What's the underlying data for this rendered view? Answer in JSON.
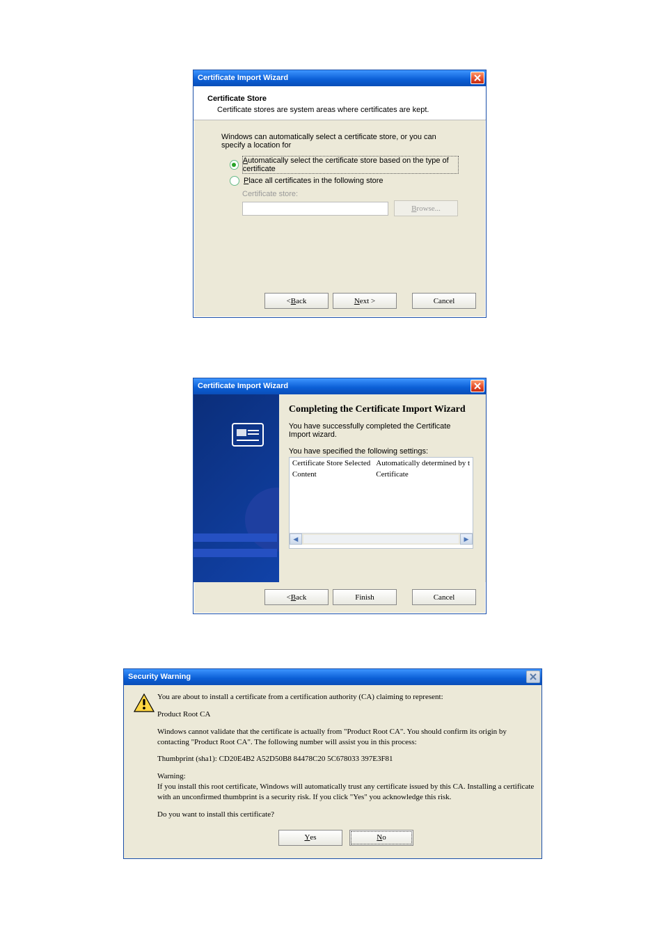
{
  "dialog1": {
    "title": "Certificate Import Wizard",
    "header_title": "Certificate Store",
    "header_sub": "Certificate stores are system areas where certificates are kept.",
    "intro": "Windows can automatically select a certificate store, or you can specify a location for",
    "option_auto_pre": "A",
    "option_auto_rest": "utomatically select the certificate store based on the type of certificate",
    "option_place_pre": "P",
    "option_place_rest": "lace all certificates in the following store",
    "cert_store_label": "Certificate store:",
    "browse_pre": "B",
    "browse_post": "rowse...",
    "back_lt": "< ",
    "back_pre": "B",
    "back_post": "ack",
    "next_pre": "N",
    "next_post": "ext >",
    "cancel": "Cancel"
  },
  "dialog2": {
    "title": "Certificate Import Wizard",
    "big_title": "Completing the Certificate Import Wizard",
    "success": "You have successfully completed the Certificate Import wizard.",
    "settings_intro": "You have specified the following settings:",
    "rows": [
      {
        "k": "Certificate Store Selected",
        "v": "Automatically determined by t"
      },
      {
        "k": "Content",
        "v": "Certificate"
      }
    ],
    "back_lt": "< ",
    "back_pre": "B",
    "back_post": "ack",
    "finish": "Finish",
    "cancel": "Cancel"
  },
  "dialog3": {
    "title": "Security Warning",
    "p1": "You are about to install a certificate from a certification authority (CA) claiming to represent:",
    "p2": "Product Root CA",
    "p3": "Windows cannot validate that the certificate is actually from \"Product Root CA\". You should confirm its origin by contacting \"Product Root CA\". The following number will assist you in this process:",
    "p4": "Thumbprint (sha1): CD20E4B2 A52D50B8 84478C20 5C678033 397E3F81",
    "p5": "Warning:",
    "p6": "If you install this root certificate, Windows will automatically trust any certificate issued by this CA. Installing a certificate with an unconfirmed thumbprint is a security risk. If you click \"Yes\" you acknowledge this risk.",
    "p7": "Do you want to install this certificate?",
    "yes_pre": "Y",
    "yes_post": "es",
    "no_pre": "N",
    "no_post": "o"
  }
}
